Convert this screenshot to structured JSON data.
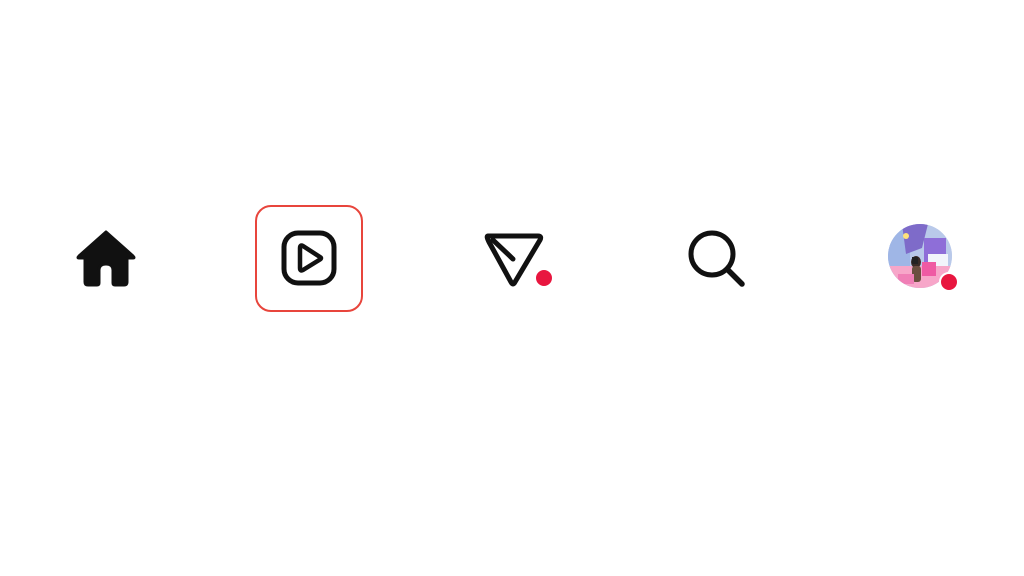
{
  "bottom_nav": {
    "active_tab": "reels",
    "items": [
      {
        "id": "home",
        "icon": "home-icon",
        "label": ""
      },
      {
        "id": "reels",
        "icon": "reels-play-icon",
        "label": "",
        "highlighted": true
      },
      {
        "id": "share",
        "icon": "paper-plane-send-icon",
        "label": "",
        "has_notification": true
      },
      {
        "id": "search",
        "icon": "search-icon",
        "label": ""
      },
      {
        "id": "profile",
        "icon": "profile-avatar",
        "label": "",
        "has_notification": true
      }
    ]
  },
  "colors": {
    "background": "#ffffff",
    "icon": "#111111",
    "highlight_border": "#e8453c",
    "notification_dot": "#e8163f"
  }
}
